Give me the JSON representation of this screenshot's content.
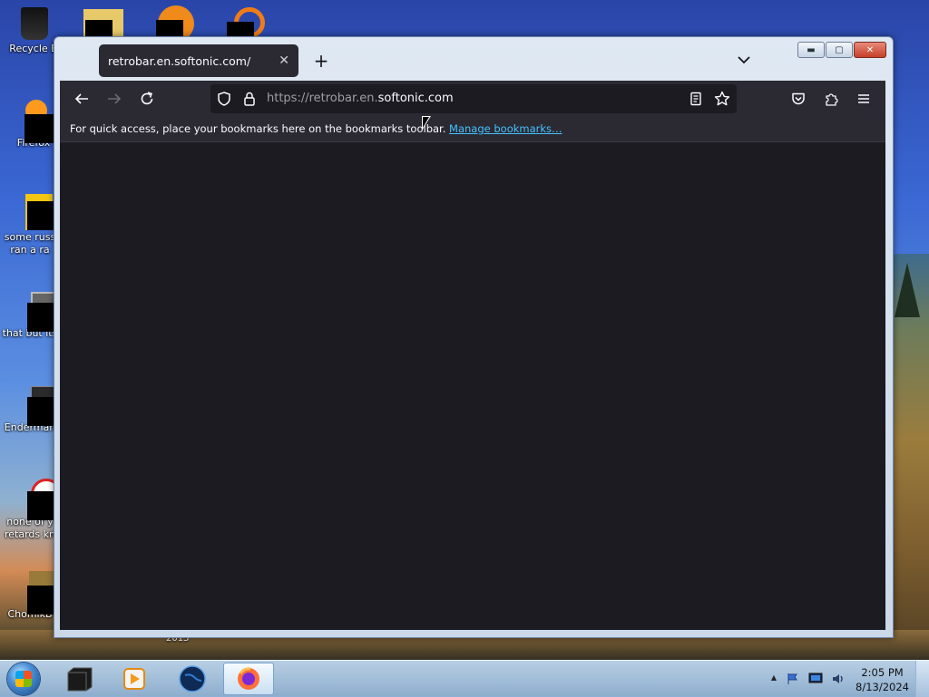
{
  "desktop": {
    "icons": [
      {
        "label": "Recycle B"
      },
      {
        "label": "Firefox"
      },
      {
        "label_line1": "some russ",
        "label_line2": "ran a ra"
      },
      {
        "label": "that but its"
      },
      {
        "label": "Enderman"
      },
      {
        "label_line1": "none of y",
        "label_line2": "retards kn"
      },
      {
        "label": "ChomikB"
      }
    ],
    "partial_label_2015": "2015"
  },
  "browser": {
    "tab": {
      "title": "retrobar.en.softonic.com/",
      "close_glyph": "✕"
    },
    "new_tab_glyph": "+",
    "tab_list_icon": "chevron-down-icon",
    "window_controls": {
      "minimize": "▬",
      "maximize": "▢",
      "close": "✕"
    },
    "url": {
      "prefix": "https://retrobar.en.",
      "domain": "softonic.com"
    },
    "bookmarks_bar": {
      "message": "For quick access, place your bookmarks here on the bookmarks toolbar.",
      "link": "Manage bookmarks…"
    }
  },
  "taskbar": {
    "clock_time": "2:05 PM",
    "clock_date": "8/13/2024",
    "tray_up_arrow": "▲"
  }
}
